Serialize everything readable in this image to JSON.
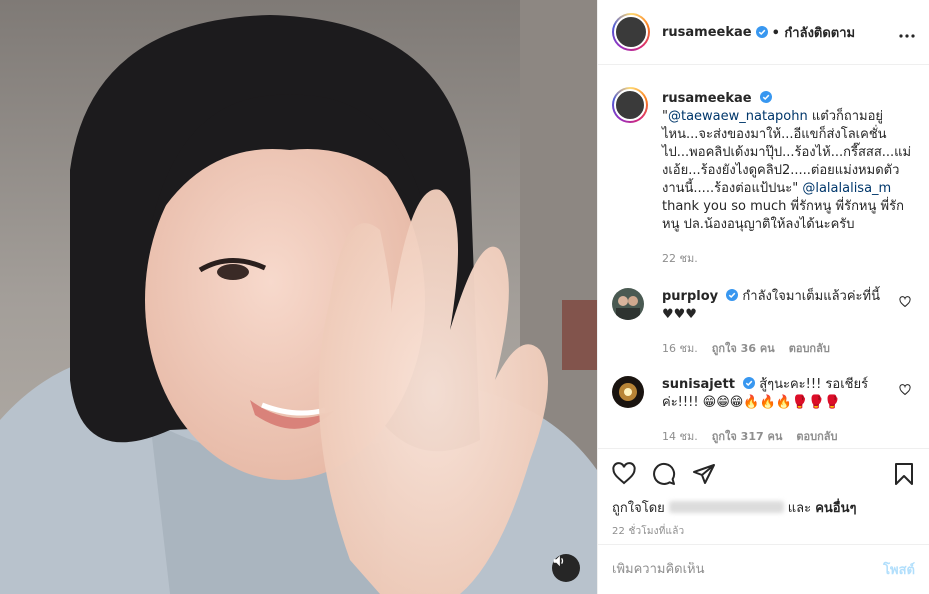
{
  "post": {
    "author": "rusameekae",
    "follow_status": "• กำลังติดตาม",
    "more_icon": "more-horizontal-icon"
  },
  "caption": {
    "username": "rusameekae",
    "lines": [
      "\"",
      "@taewaew_natapohn",
      " แต๋วก็ถามอยู่ไหน...จะส่งของมาให้...อีแขก็ส่งโลเคชั่นไป...พอคลิปเด้งมาปุ๊ป...ร้องไห้...กรี๊สสส...แม่งเอ้ย...ร้องยังไงดูคลิป2.....ต่อยแม่งหมดตัวงานนี้.....ร้องต่อแป้ปนะ\" ",
      "@lalalalisa_m",
      " thank you so much พี่รักหนู พี่รักหนู พี่รักหนู ปล.น้องอนุญาติให้ลงได้นะครับ"
    ],
    "time": "22 ชม."
  },
  "comments": [
    {
      "username": "purploy",
      "text": "กำลังใจมาเต็มแล้วค่ะที่นี้ ♥♥♥",
      "time": "16 ชม.",
      "likes": "ถูกใจ 36 คน",
      "reply": "ตอบกลับ"
    },
    {
      "username": "sunisajett",
      "text": "สู้ๆนะคะ!!! รอเชียร์ค่ะ!!!! 😁😁😁🔥🔥🔥🥊🥊🥊",
      "time": "14 ชม.",
      "likes": "ถูกใจ 317 คน",
      "reply": "ตอบกลับ"
    }
  ],
  "actions": {
    "liked_by_prefix": "ถูกใจโดย",
    "liked_by_and": "และ",
    "liked_by_others": "คนอื่นๆ",
    "timestamp": "22 ชั่วโมงที่แล้ว"
  },
  "add_comment": {
    "placeholder": "เพิ่มความคิดเห็น",
    "post_label": "โพสต์"
  },
  "colors": {
    "verified": "#3897f0",
    "mention": "#00376b",
    "post_disabled": "#b2dffc",
    "muted": "#8e8e8e"
  }
}
